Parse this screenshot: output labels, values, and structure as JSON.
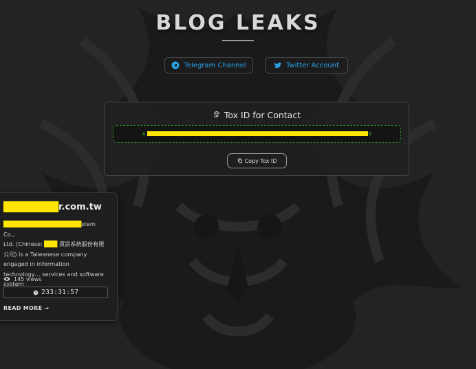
{
  "page": {
    "title": "BLOG LEAKS"
  },
  "social": {
    "telegram_label": "Telegram Channel",
    "twitter_label": "Twitter Account",
    "accent_color": "#2aa3e8"
  },
  "tox": {
    "heading": "Tox ID for Contact",
    "id_first_char": "A",
    "id_last_char": "D",
    "copy_label": "Copy Tox ID",
    "field_border_color": "#2f8f2f"
  },
  "post": {
    "title_visible": "r.com.tw",
    "title_redacted_part": "████████",
    "desc_line1_visible": "stem Co.,",
    "desc_line2_a": "Ltd. (Chinese:",
    "desc_line2_b": "資訊系統股份有限",
    "desc_rest": "公司) is a Taiwanese company engaged in information technology… services and software system",
    "views": "145 views",
    "timer": "233:31:57",
    "read_more": "READ MORE →",
    "redaction_color": "#ffe600"
  }
}
